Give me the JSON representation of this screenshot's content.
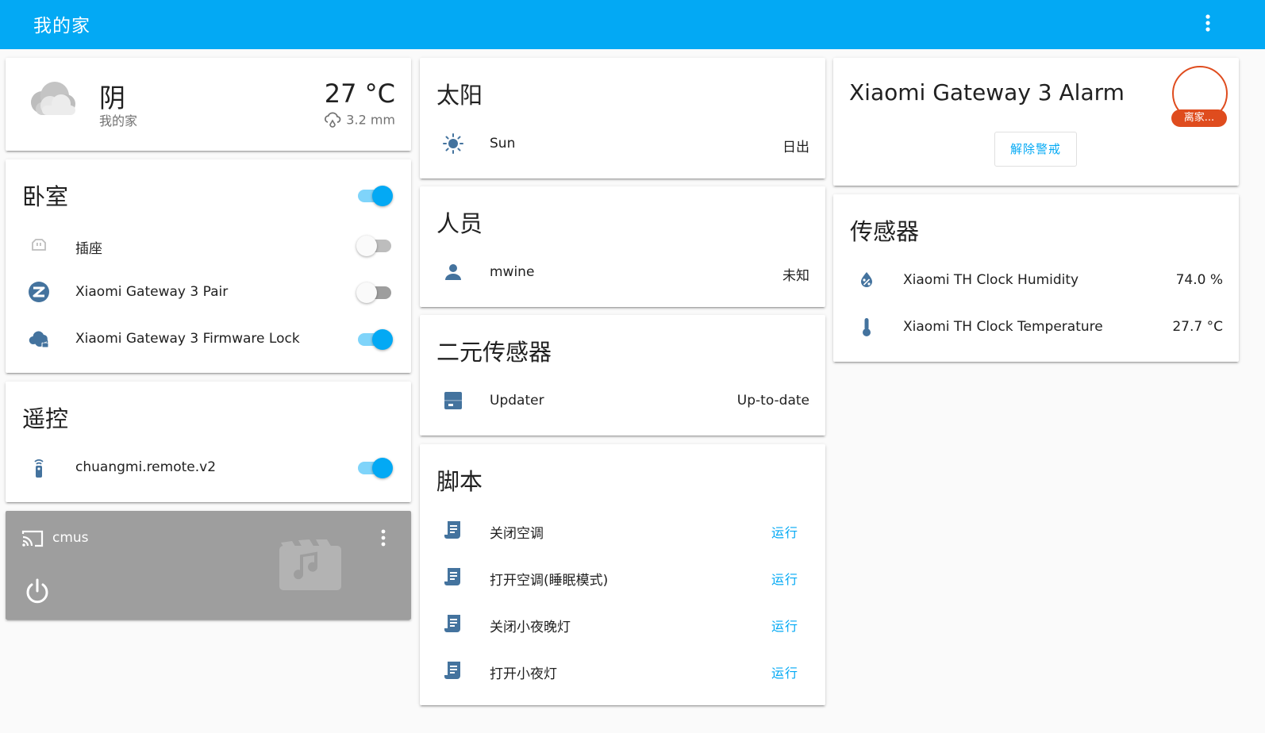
{
  "app": {
    "title": "我的家"
  },
  "weather": {
    "condition": "阴",
    "location": "我的家",
    "temperature": "27 °C",
    "precipitation": "3.2 mm"
  },
  "bedroom": {
    "title": "卧室",
    "items": [
      {
        "name": "插座",
        "icon": "power-socket-icon",
        "on": false
      },
      {
        "name": "Xiaomi Gateway 3 Pair",
        "icon": "zigbee-icon",
        "on": false
      },
      {
        "name": "Xiaomi Gateway 3 Firmware Lock",
        "icon": "cloud-lock-icon",
        "on": true
      }
    ],
    "all_on": true
  },
  "remote": {
    "title": "遥控",
    "items": [
      {
        "name": "chuangmi.remote.v2",
        "icon": "remote-icon",
        "on": true
      }
    ]
  },
  "media": {
    "name": "cmus"
  },
  "sun": {
    "title": "太阳",
    "entity": "Sun",
    "state": "日出"
  },
  "people": {
    "title": "人员",
    "entity": "mwine",
    "state": "未知"
  },
  "binary": {
    "title": "二元传感器",
    "entity": "Updater",
    "state": "Up-to-date"
  },
  "scripts": {
    "title": "脚本",
    "run_label": "运行",
    "items": [
      {
        "name": "关闭空调"
      },
      {
        "name": "打开空调(睡眠模式)"
      },
      {
        "name": "关闭小夜晚灯"
      },
      {
        "name": "打开小夜灯"
      }
    ]
  },
  "alarm": {
    "title": "Xiaomi Gateway 3 Alarm",
    "badge": "离家...",
    "disarm_label": "解除警戒"
  },
  "sensors": {
    "title": "传感器",
    "items": [
      {
        "name": "Xiaomi TH Clock Humidity",
        "value": "74.0 %",
        "icon": "water-percent-icon"
      },
      {
        "name": "Xiaomi TH Clock Temperature",
        "value": "27.7 °C",
        "icon": "thermometer-icon"
      }
    ]
  },
  "colors": {
    "primary": "#03a9f4",
    "icon": "#44739e",
    "alarm": "#df4c1e",
    "media_bg": "#9e9e9e"
  }
}
